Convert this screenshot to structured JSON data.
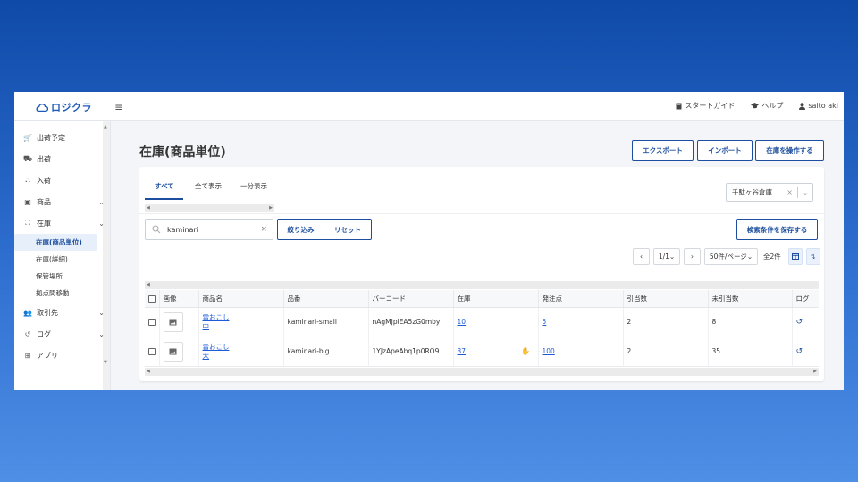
{
  "header": {
    "logo_text": "ロジクラ",
    "menu_icon": "hamburger-icon",
    "nav": [
      {
        "label": "スタートガイド",
        "icon": "book-icon"
      },
      {
        "label": "ヘルプ",
        "icon": "graduation-cap-icon"
      },
      {
        "label": "saito aki",
        "icon": "user-icon"
      }
    ]
  },
  "sidebar": {
    "items": [
      {
        "label": "出荷予定",
        "icon": "cart-icon"
      },
      {
        "label": "出荷",
        "icon": "truck-icon"
      },
      {
        "label": "入荷",
        "icon": "dolly-icon"
      },
      {
        "label": "商品",
        "icon": "box-icon"
      },
      {
        "label": "在庫",
        "icon": "boxes-icon"
      },
      {
        "label": "取引先",
        "icon": "users-icon"
      },
      {
        "label": "ログ",
        "icon": "history-icon"
      },
      {
        "label": "アプリ",
        "icon": "grid-icon"
      }
    ],
    "stock_sub": [
      "在庫(商品単位)",
      "在庫(詳細)",
      "保管場所",
      "拠点間移動"
    ]
  },
  "page": {
    "title": "在庫(商品単位)",
    "actions": {
      "export": "エクスポート",
      "import": "インポート",
      "operate": "在庫を操作する"
    },
    "tabs": [
      "すべて",
      "全て表示",
      "一分表示"
    ],
    "warehouse": "千駄ヶ谷倉庫",
    "search": {
      "value": "kaminari"
    },
    "filter": {
      "apply": "絞り込み",
      "reset": "リセット"
    },
    "save_search": "検索条件を保存する",
    "pager": {
      "page": "1/1",
      "per_page": "50件/ページ",
      "total": "全2件"
    }
  },
  "table": {
    "headers": [
      "画像",
      "商品名",
      "品番",
      "バーコード",
      "在庫",
      "発注点",
      "引当数",
      "未引当数",
      "ログ"
    ],
    "rows": [
      {
        "name1": "雷おこし",
        "name2": "中",
        "code": "kaminari-small",
        "barcode": "nAgMJplEA5zG0mby",
        "stock": "10",
        "reorder": "5",
        "allocated": "2",
        "unallocated": "8",
        "alert": false
      },
      {
        "name1": "雷おこし",
        "name2": "大",
        "code": "kaminari-big",
        "barcode": "1YJzApeAbq1p0RO9",
        "stock": "37",
        "reorder": "100",
        "allocated": "2",
        "unallocated": "35",
        "alert": true
      }
    ]
  },
  "colors": {
    "primary": "#1d4f9e",
    "link": "#1d5bd8",
    "background_top": "#0f4aa8",
    "background_bottom": "#4f8fe6"
  }
}
